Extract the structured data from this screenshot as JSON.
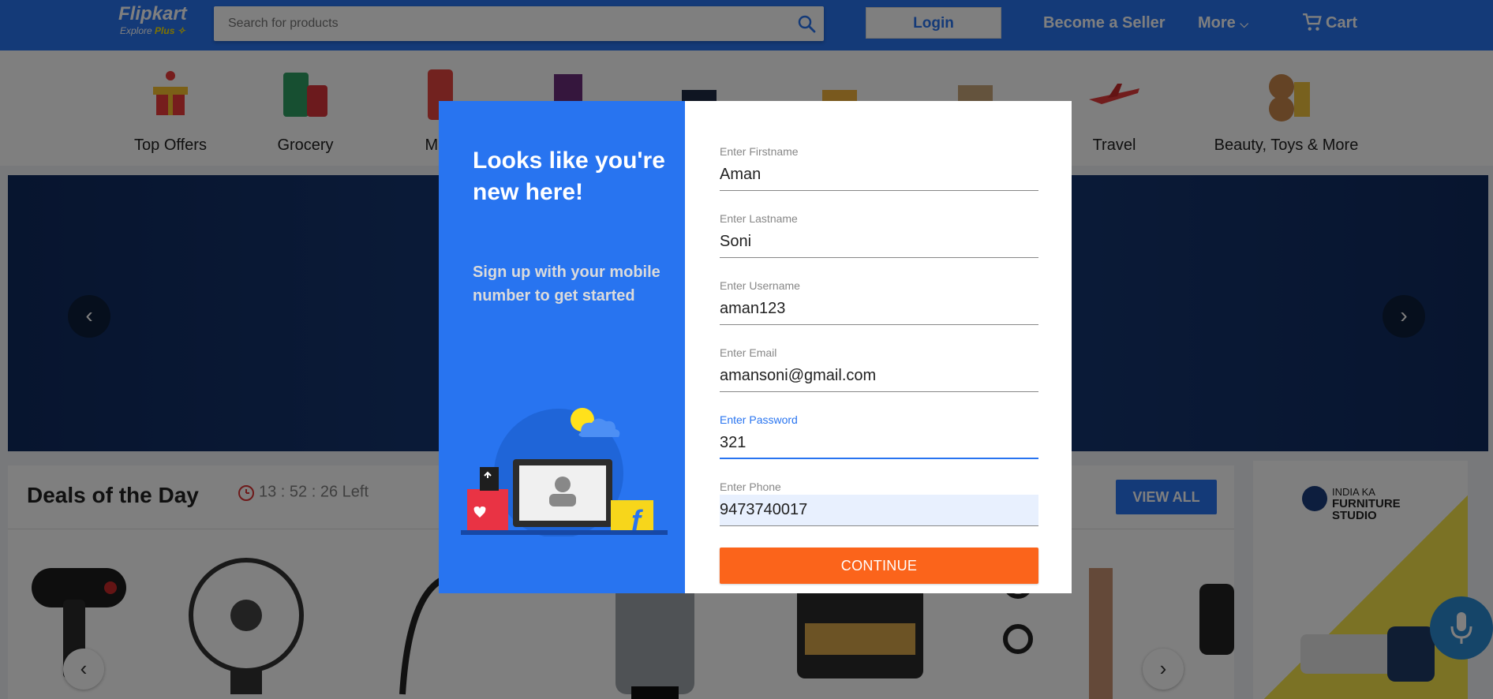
{
  "header": {
    "logo": "Flipkart",
    "logo_sub": "Explore",
    "logo_plus": "Plus",
    "search_placeholder": "Search for products",
    "login_label": "Login",
    "become_seller": "Become a Seller",
    "more": "More",
    "cart": "Cart",
    "brand_color": "#2874f0"
  },
  "categories": [
    {
      "label": "Top Offers"
    },
    {
      "label": "Grocery"
    },
    {
      "label": "Mob"
    },
    {
      "label": ""
    },
    {
      "label": ""
    },
    {
      "label": ""
    },
    {
      "label": ""
    },
    {
      "label": "Travel"
    },
    {
      "label": "Beauty, Toys & More"
    }
  ],
  "deals": {
    "title": "Deals of the Day",
    "timer": "13 : 52 : 26 Left",
    "view_all": "VIEW ALL"
  },
  "side_ad": {
    "line1": "INDIA KA",
    "line2": "FURNITURE",
    "line3": "STUDIO"
  },
  "modal": {
    "title": "Looks like you're new here!",
    "subtitle": "Sign up with your mobile number to get started",
    "fields": [
      {
        "label": "Enter Firstname",
        "value": "Aman"
      },
      {
        "label": "Enter Lastname",
        "value": "Soni"
      },
      {
        "label": "Enter Username",
        "value": "aman123"
      },
      {
        "label": "Enter Email",
        "value": "amansoni@gmail.com"
      },
      {
        "label": "Enter Password",
        "value": "321"
      },
      {
        "label": "Enter Phone",
        "value": "9473740017"
      }
    ],
    "continue_label": "CONTINUE",
    "accent_color": "#fb641b"
  }
}
